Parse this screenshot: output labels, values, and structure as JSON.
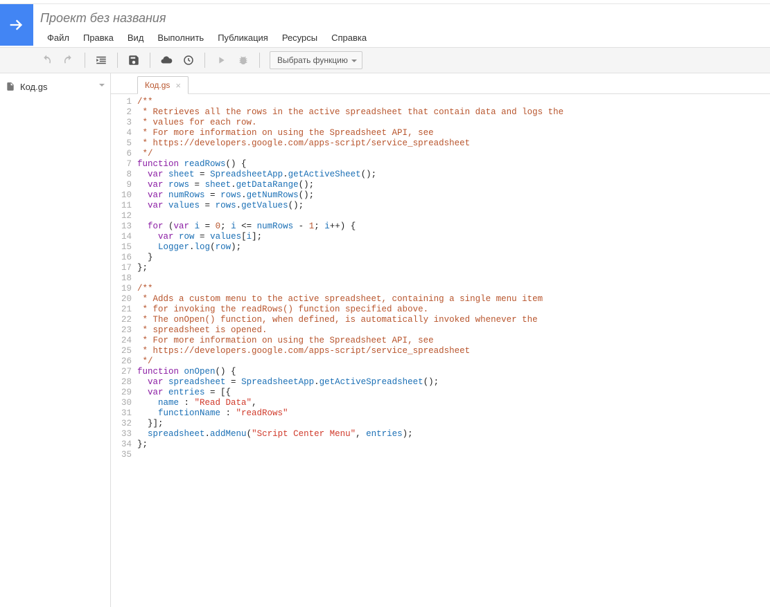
{
  "project_title": "Проект без названия",
  "menu": [
    "Файл",
    "Правка",
    "Вид",
    "Выполнить",
    "Публикация",
    "Ресурсы",
    "Справка"
  ],
  "toolbar": {
    "function_select_label": "Выбрать функцию"
  },
  "sidebar": {
    "files": [
      {
        "name": "Код.gs"
      }
    ]
  },
  "editor": {
    "tab_label": "Код.gs",
    "lines": [
      [
        {
          "t": "/**",
          "c": "c-doc"
        }
      ],
      [
        {
          "t": " * Retrieves all the rows in the active spreadsheet that contain data and logs the",
          "c": "c-doc"
        }
      ],
      [
        {
          "t": " * values for each row.",
          "c": "c-doc"
        }
      ],
      [
        {
          "t": " * For more information on using the Spreadsheet API, see",
          "c": "c-doc"
        }
      ],
      [
        {
          "t": " * https://developers.google.com/apps-script/service_spreadsheet",
          "c": "c-doc"
        }
      ],
      [
        {
          "t": " */",
          "c": "c-doc"
        }
      ],
      [
        {
          "t": "function ",
          "c": "c-kw"
        },
        {
          "t": "readRows",
          "c": "c-var"
        },
        {
          "t": "() {",
          "c": "c-pln"
        }
      ],
      [
        {
          "t": "  ",
          "c": "c-pln"
        },
        {
          "t": "var ",
          "c": "c-kw"
        },
        {
          "t": "sheet",
          "c": "c-var"
        },
        {
          "t": " = ",
          "c": "c-pln"
        },
        {
          "t": "SpreadsheetApp",
          "c": "c-var"
        },
        {
          "t": ".",
          "c": "c-pln"
        },
        {
          "t": "getActiveSheet",
          "c": "c-var"
        },
        {
          "t": "();",
          "c": "c-pln"
        }
      ],
      [
        {
          "t": "  ",
          "c": "c-pln"
        },
        {
          "t": "var ",
          "c": "c-kw"
        },
        {
          "t": "rows",
          "c": "c-var"
        },
        {
          "t": " = ",
          "c": "c-pln"
        },
        {
          "t": "sheet",
          "c": "c-var"
        },
        {
          "t": ".",
          "c": "c-pln"
        },
        {
          "t": "getDataRange",
          "c": "c-var"
        },
        {
          "t": "();",
          "c": "c-pln"
        }
      ],
      [
        {
          "t": "  ",
          "c": "c-pln"
        },
        {
          "t": "var ",
          "c": "c-kw"
        },
        {
          "t": "numRows",
          "c": "c-var"
        },
        {
          "t": " = ",
          "c": "c-pln"
        },
        {
          "t": "rows",
          "c": "c-var"
        },
        {
          "t": ".",
          "c": "c-pln"
        },
        {
          "t": "getNumRows",
          "c": "c-var"
        },
        {
          "t": "();",
          "c": "c-pln"
        }
      ],
      [
        {
          "t": "  ",
          "c": "c-pln"
        },
        {
          "t": "var ",
          "c": "c-kw"
        },
        {
          "t": "values",
          "c": "c-var"
        },
        {
          "t": " = ",
          "c": "c-pln"
        },
        {
          "t": "rows",
          "c": "c-var"
        },
        {
          "t": ".",
          "c": "c-pln"
        },
        {
          "t": "getValues",
          "c": "c-var"
        },
        {
          "t": "();",
          "c": "c-pln"
        }
      ],
      [
        {
          "t": "",
          "c": "c-pln"
        }
      ],
      [
        {
          "t": "  ",
          "c": "c-pln"
        },
        {
          "t": "for ",
          "c": "c-kw"
        },
        {
          "t": "(",
          "c": "c-pln"
        },
        {
          "t": "var ",
          "c": "c-kw"
        },
        {
          "t": "i",
          "c": "c-var"
        },
        {
          "t": " = ",
          "c": "c-pln"
        },
        {
          "t": "0",
          "c": "c-num"
        },
        {
          "t": "; ",
          "c": "c-pln"
        },
        {
          "t": "i",
          "c": "c-var"
        },
        {
          "t": " <= ",
          "c": "c-pln"
        },
        {
          "t": "numRows",
          "c": "c-var"
        },
        {
          "t": " - ",
          "c": "c-pln"
        },
        {
          "t": "1",
          "c": "c-num"
        },
        {
          "t": "; ",
          "c": "c-pln"
        },
        {
          "t": "i",
          "c": "c-var"
        },
        {
          "t": "++) {",
          "c": "c-pln"
        }
      ],
      [
        {
          "t": "    ",
          "c": "c-pln"
        },
        {
          "t": "var ",
          "c": "c-kw"
        },
        {
          "t": "row",
          "c": "c-var"
        },
        {
          "t": " = ",
          "c": "c-pln"
        },
        {
          "t": "values",
          "c": "c-var"
        },
        {
          "t": "[",
          "c": "c-pln"
        },
        {
          "t": "i",
          "c": "c-var"
        },
        {
          "t": "];",
          "c": "c-pln"
        }
      ],
      [
        {
          "t": "    ",
          "c": "c-pln"
        },
        {
          "t": "Logger",
          "c": "c-var"
        },
        {
          "t": ".",
          "c": "c-pln"
        },
        {
          "t": "log",
          "c": "c-var"
        },
        {
          "t": "(",
          "c": "c-pln"
        },
        {
          "t": "row",
          "c": "c-var"
        },
        {
          "t": ");",
          "c": "c-pln"
        }
      ],
      [
        {
          "t": "  }",
          "c": "c-pln"
        }
      ],
      [
        {
          "t": "};",
          "c": "c-pln"
        }
      ],
      [
        {
          "t": "",
          "c": "c-pln"
        }
      ],
      [
        {
          "t": "/**",
          "c": "c-doc"
        }
      ],
      [
        {
          "t": " * Adds a custom menu to the active spreadsheet, containing a single menu item",
          "c": "c-doc"
        }
      ],
      [
        {
          "t": " * for invoking the readRows() function specified above.",
          "c": "c-doc"
        }
      ],
      [
        {
          "t": " * The onOpen() function, when defined, is automatically invoked whenever the",
          "c": "c-doc"
        }
      ],
      [
        {
          "t": " * spreadsheet is opened.",
          "c": "c-doc"
        }
      ],
      [
        {
          "t": " * For more information on using the Spreadsheet API, see",
          "c": "c-doc"
        }
      ],
      [
        {
          "t": " * https://developers.google.com/apps-script/service_spreadsheet",
          "c": "c-doc"
        }
      ],
      [
        {
          "t": " */",
          "c": "c-doc"
        }
      ],
      [
        {
          "t": "function ",
          "c": "c-kw"
        },
        {
          "t": "onOpen",
          "c": "c-var"
        },
        {
          "t": "() {",
          "c": "c-pln"
        }
      ],
      [
        {
          "t": "  ",
          "c": "c-pln"
        },
        {
          "t": "var ",
          "c": "c-kw"
        },
        {
          "t": "spreadsheet",
          "c": "c-var"
        },
        {
          "t": " = ",
          "c": "c-pln"
        },
        {
          "t": "SpreadsheetApp",
          "c": "c-var"
        },
        {
          "t": ".",
          "c": "c-pln"
        },
        {
          "t": "getActiveSpreadsheet",
          "c": "c-var"
        },
        {
          "t": "();",
          "c": "c-pln"
        }
      ],
      [
        {
          "t": "  ",
          "c": "c-pln"
        },
        {
          "t": "var ",
          "c": "c-kw"
        },
        {
          "t": "entries",
          "c": "c-var"
        },
        {
          "t": " = [{",
          "c": "c-pln"
        }
      ],
      [
        {
          "t": "    ",
          "c": "c-pln"
        },
        {
          "t": "name",
          "c": "c-var"
        },
        {
          "t": " : ",
          "c": "c-pln"
        },
        {
          "t": "\"Read Data\"",
          "c": "c-str"
        },
        {
          "t": ",",
          "c": "c-pln"
        }
      ],
      [
        {
          "t": "    ",
          "c": "c-pln"
        },
        {
          "t": "functionName",
          "c": "c-var"
        },
        {
          "t": " : ",
          "c": "c-pln"
        },
        {
          "t": "\"readRows\"",
          "c": "c-str"
        }
      ],
      [
        {
          "t": "  }];",
          "c": "c-pln"
        }
      ],
      [
        {
          "t": "  ",
          "c": "c-pln"
        },
        {
          "t": "spreadsheet",
          "c": "c-var"
        },
        {
          "t": ".",
          "c": "c-pln"
        },
        {
          "t": "addMenu",
          "c": "c-var"
        },
        {
          "t": "(",
          "c": "c-pln"
        },
        {
          "t": "\"Script Center Menu\"",
          "c": "c-str"
        },
        {
          "t": ", ",
          "c": "c-pln"
        },
        {
          "t": "entries",
          "c": "c-var"
        },
        {
          "t": ");",
          "c": "c-pln"
        }
      ],
      [
        {
          "t": "};",
          "c": "c-pln"
        }
      ],
      [
        {
          "t": "",
          "c": "c-pln"
        }
      ]
    ]
  }
}
